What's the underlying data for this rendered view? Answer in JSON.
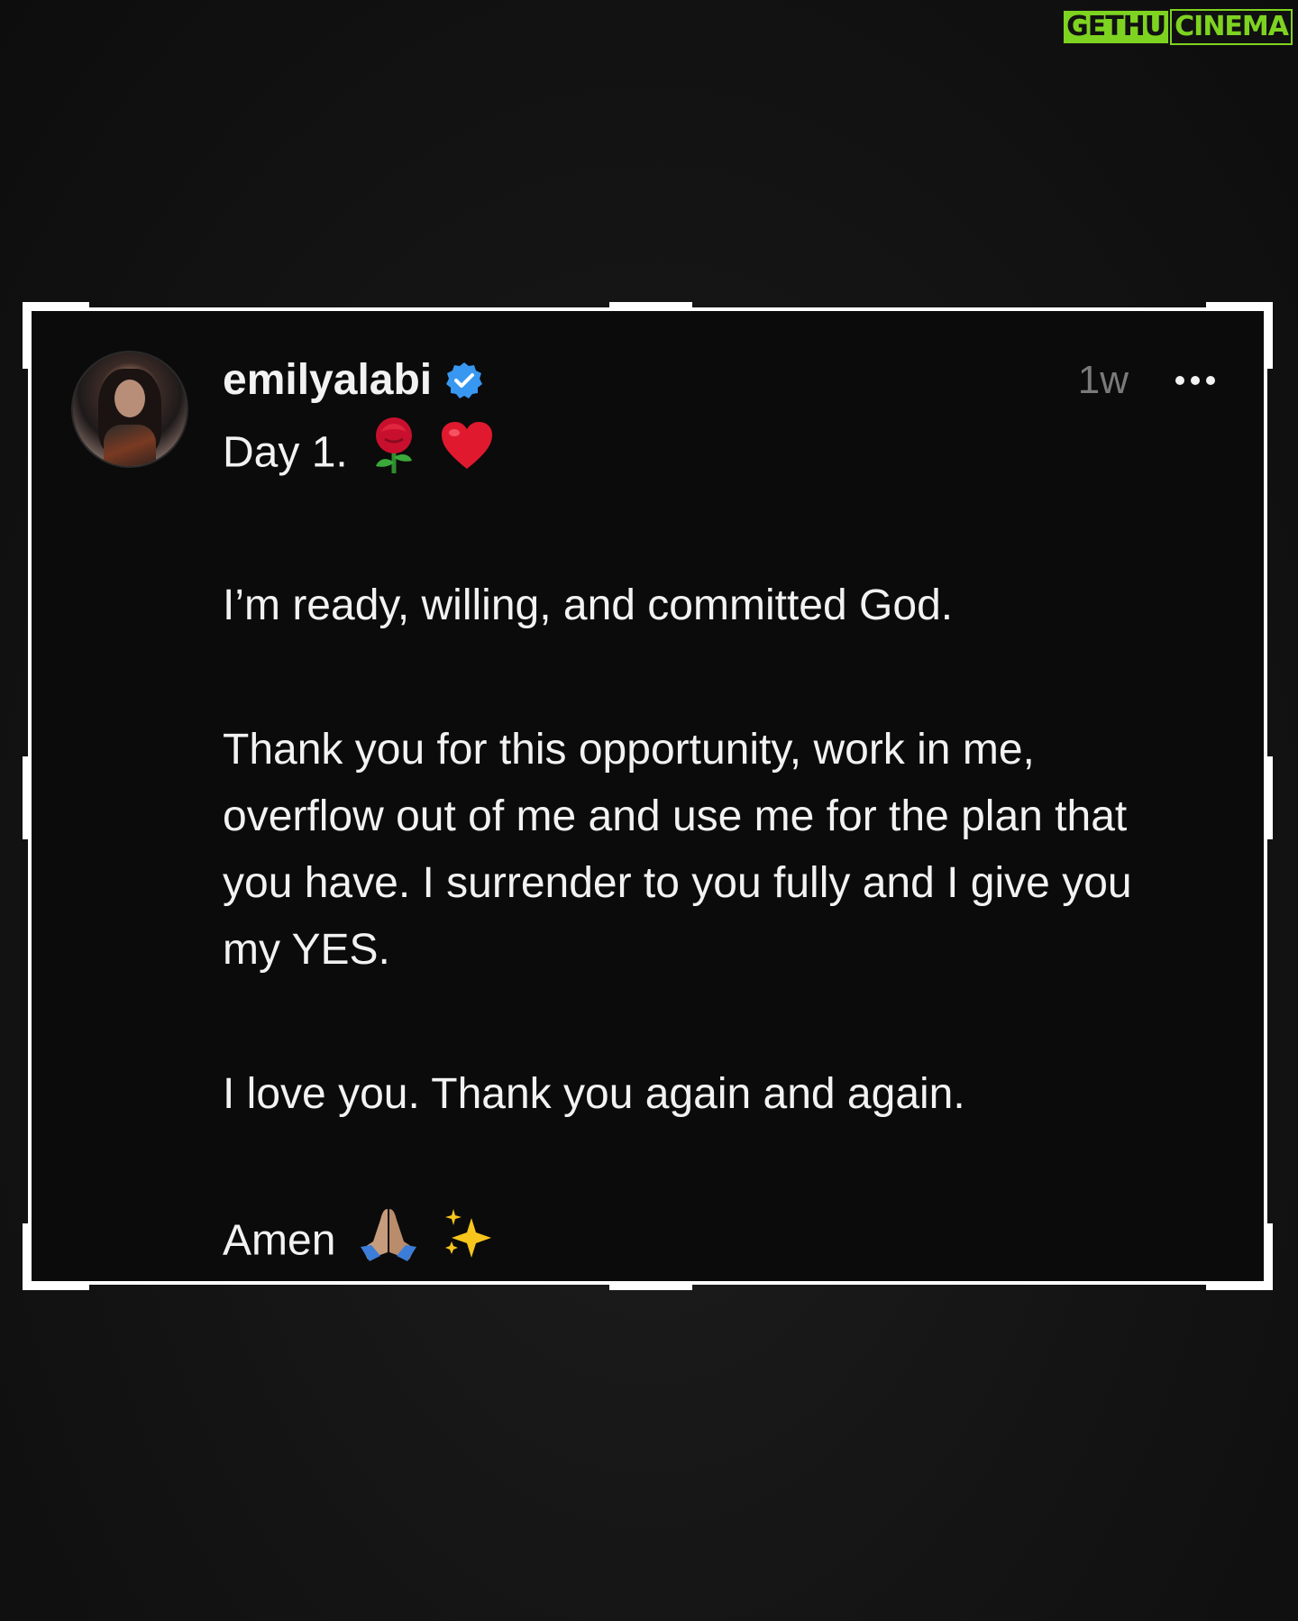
{
  "watermark": {
    "part1": "GETHU",
    "part2": "CINEMA"
  },
  "post": {
    "username": "emilyalabi",
    "time_ago": "1w",
    "verified_icon": "verified-badge-icon",
    "avatar_icon": "profile-avatar",
    "more_icon": "more-options-icon",
    "colors": {
      "verified": "#3897f0",
      "text": "#f2f2f2",
      "muted": "#7a7a7a",
      "background": "#0b0b0b"
    },
    "lines": {
      "line1": "Day 1.",
      "line1_emoji": [
        "rose-emoji",
        "red-heart-emoji"
      ],
      "para1": "I’m ready, willing, and committed God.",
      "para2": "Thank you for this opportunity, work in me, overflow out of me and use me for the plan that you have. I surrender to you fully and I give you my YES.",
      "para3": "I love you. Thank you again and again.",
      "line_last": "Amen",
      "line_last_emoji": [
        "folded-hands-emoji",
        "sparkles-emoji"
      ]
    }
  }
}
